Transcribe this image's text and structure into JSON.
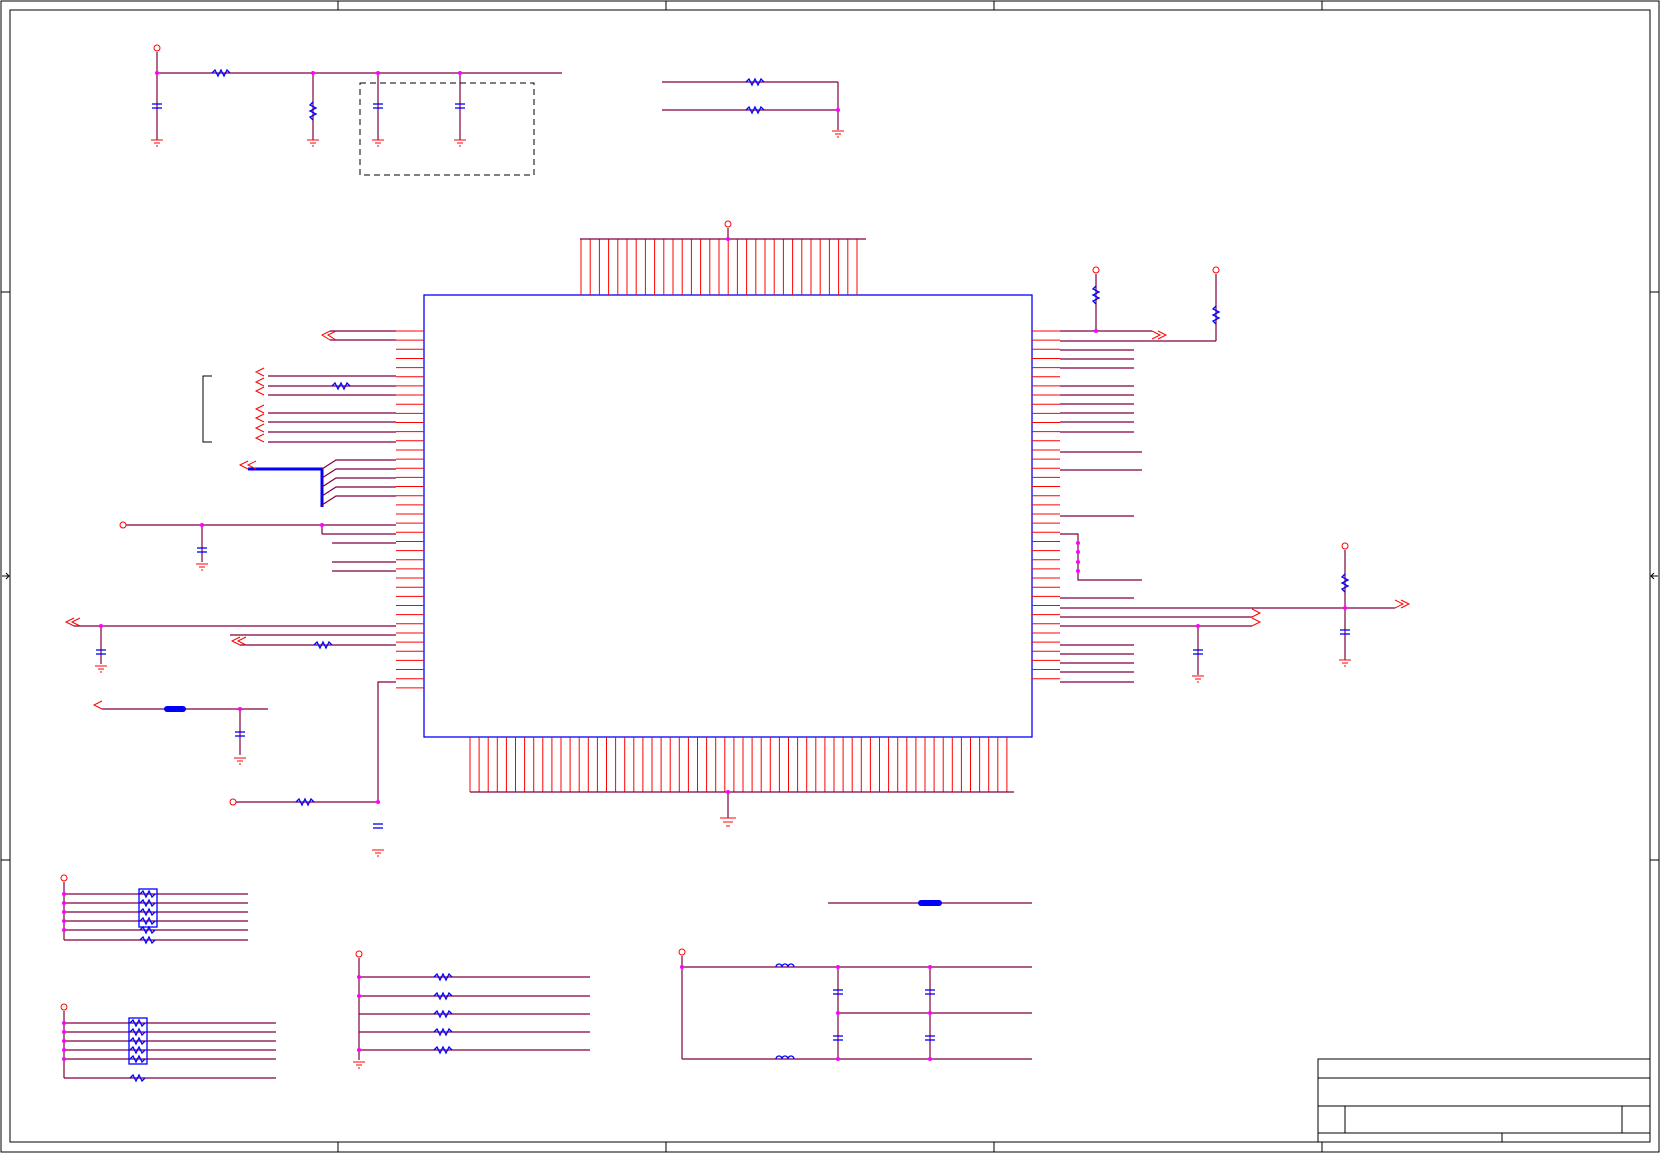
{
  "diagram": {
    "kind": "schematic",
    "colors": {
      "frame": "#000000",
      "wire": "#800040",
      "pin": "#ff0000",
      "part": "#0000ff",
      "junction": "#ff00ff"
    },
    "labels": []
  }
}
